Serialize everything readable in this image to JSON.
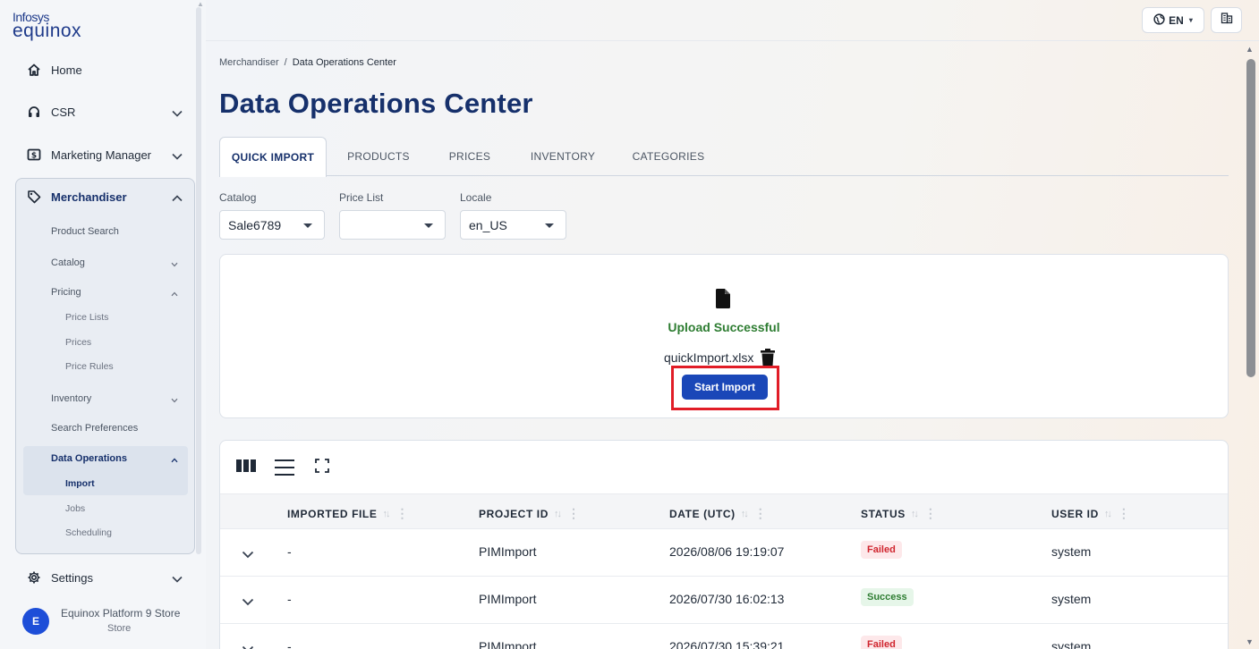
{
  "brand": {
    "line1": "Infosys",
    "line2": "equinox"
  },
  "sidebar": {
    "home": "Home",
    "csr": "CSR",
    "marketing": "Marketing Manager",
    "merchandiser": "Merchandiser",
    "product_search": "Product Search",
    "catalog": "Catalog",
    "pricing": "Pricing",
    "price_lists": "Price Lists",
    "prices": "Prices",
    "price_rules": "Price Rules",
    "inventory": "Inventory",
    "search_preferences": "Search Preferences",
    "data_operations": "Data Operations",
    "import": "Import",
    "jobs": "Jobs",
    "scheduling": "Scheduling",
    "settings": "Settings"
  },
  "user": {
    "initial": "E",
    "name": "Equinox Platform 9 Store",
    "sub": "Store"
  },
  "topbar": {
    "language": "EN"
  },
  "breadcrumb": {
    "parent": "Merchandiser",
    "separator": "/",
    "current": "Data Operations Center"
  },
  "page_title": "Data Operations Center",
  "tabs": [
    "QUICK IMPORT",
    "PRODUCTS",
    "PRICES",
    "INVENTORY",
    "CATEGORIES"
  ],
  "filters": {
    "catalog": {
      "label": "Catalog",
      "value": "Sale6789"
    },
    "price_list": {
      "label": "Price List",
      "value": ""
    },
    "locale": {
      "label": "Locale",
      "value": "en_US"
    }
  },
  "upload": {
    "message": "Upload Successful",
    "file_name": "quickImport.xlsx",
    "start_button": "Start Import"
  },
  "table": {
    "columns": [
      "IMPORTED FILE",
      "PROJECT ID",
      "DATE (UTC)",
      "STATUS",
      "USER ID"
    ],
    "rows": [
      {
        "file": "-",
        "project": "PIMImport",
        "date": "2026/08/06 19:19:07",
        "status": "Failed",
        "user": "system"
      },
      {
        "file": "-",
        "project": "PIMImport",
        "date": "2026/07/30 16:02:13",
        "status": "Success",
        "user": "system"
      },
      {
        "file": "-",
        "project": "PIMImport",
        "date": "2026/07/30 15:39:21",
        "status": "Failed",
        "user": "system"
      }
    ]
  },
  "colors": {
    "primary": "#1a47b8",
    "title": "#16306b",
    "success": "#2e7d32",
    "failed": "#d0262f",
    "highlight": "#e11d27"
  },
  "icons": {
    "home": "home-icon",
    "csr": "headset-icon",
    "marketing": "dollar-bill-icon",
    "merchandiser": "tag-icon",
    "settings": "gear-icon",
    "language": "globe-icon",
    "store": "building-icon",
    "file": "file-icon",
    "trash": "trash-icon",
    "columns": "columns-icon",
    "density": "density-icon",
    "fullscreen": "fullscreen-icon",
    "expand": "chevron-down-icon"
  }
}
